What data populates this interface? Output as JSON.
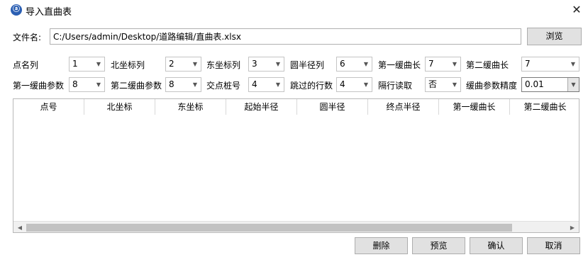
{
  "window": {
    "title": "导入直曲表",
    "icon_glyph": "ⓐ",
    "close_glyph": "✕"
  },
  "file": {
    "label": "文件名:",
    "value": "C:/Users/admin/Desktop/道路编辑/直曲表.xlsx",
    "browse_label": "浏览"
  },
  "params_row1": [
    {
      "label": "点名列",
      "value": "1"
    },
    {
      "label": "北坐标列",
      "value": "2"
    },
    {
      "label": "东坐标列",
      "value": "3"
    },
    {
      "label": "圆半径列",
      "value": "6"
    },
    {
      "label": "第一缓曲长",
      "value": "7"
    },
    {
      "label": "第二缓曲长",
      "value": "7"
    }
  ],
  "params_row2": [
    {
      "label": "第一缓曲参数",
      "value": "8"
    },
    {
      "label": "第二缓曲参数",
      "value": "8"
    },
    {
      "label": "交点桩号",
      "value": "4"
    },
    {
      "label": "跳过的行数",
      "value": "4"
    },
    {
      "label": "隔行读取",
      "value": "否"
    },
    {
      "label": "缓曲参数精度",
      "value": "0.01"
    }
  ],
  "dropdown_arrow": "▼",
  "table": {
    "columns": [
      "点号",
      "北坐标",
      "东坐标",
      "起始半径",
      "圆半径",
      "终点半径",
      "第一缓曲长",
      "第二缓曲长"
    ],
    "rows": []
  },
  "scrollbar": {
    "left_arrow": "◀",
    "right_arrow": "▶"
  },
  "buttons": {
    "delete": "删除",
    "preview": "预览",
    "confirm": "确认",
    "cancel": "取消"
  }
}
